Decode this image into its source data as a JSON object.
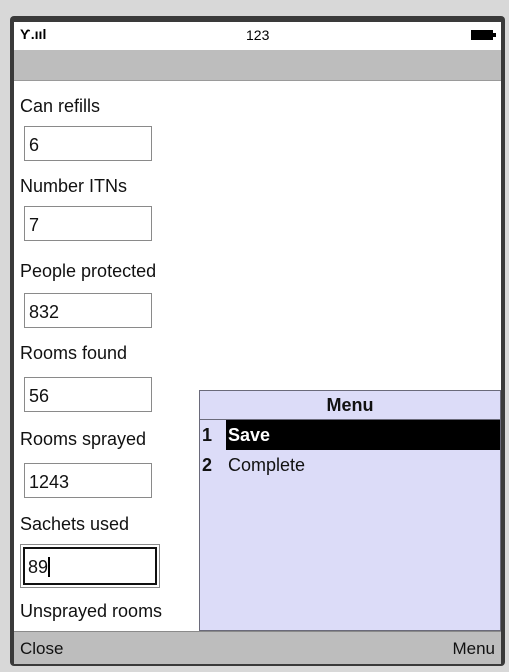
{
  "status": {
    "clock": "123",
    "signal_icon": "signal-icon",
    "battery_icon": "battery-icon"
  },
  "form": {
    "fields": [
      {
        "label": "Can refills",
        "value": "6"
      },
      {
        "label": "Number ITNs",
        "value": "7"
      },
      {
        "label": "People protected",
        "value": "832"
      },
      {
        "label": "Rooms found",
        "value": "56"
      },
      {
        "label": "Rooms sprayed",
        "value": "1243"
      },
      {
        "label": "Sachets used",
        "value": "89"
      }
    ],
    "last_label": "Unsprayed rooms"
  },
  "menu": {
    "title": "Menu",
    "items": [
      {
        "num": "1",
        "label": "Save"
      },
      {
        "num": "2",
        "label": "Complete"
      }
    ]
  },
  "softkeys": {
    "left": "Close",
    "right": "Menu"
  }
}
